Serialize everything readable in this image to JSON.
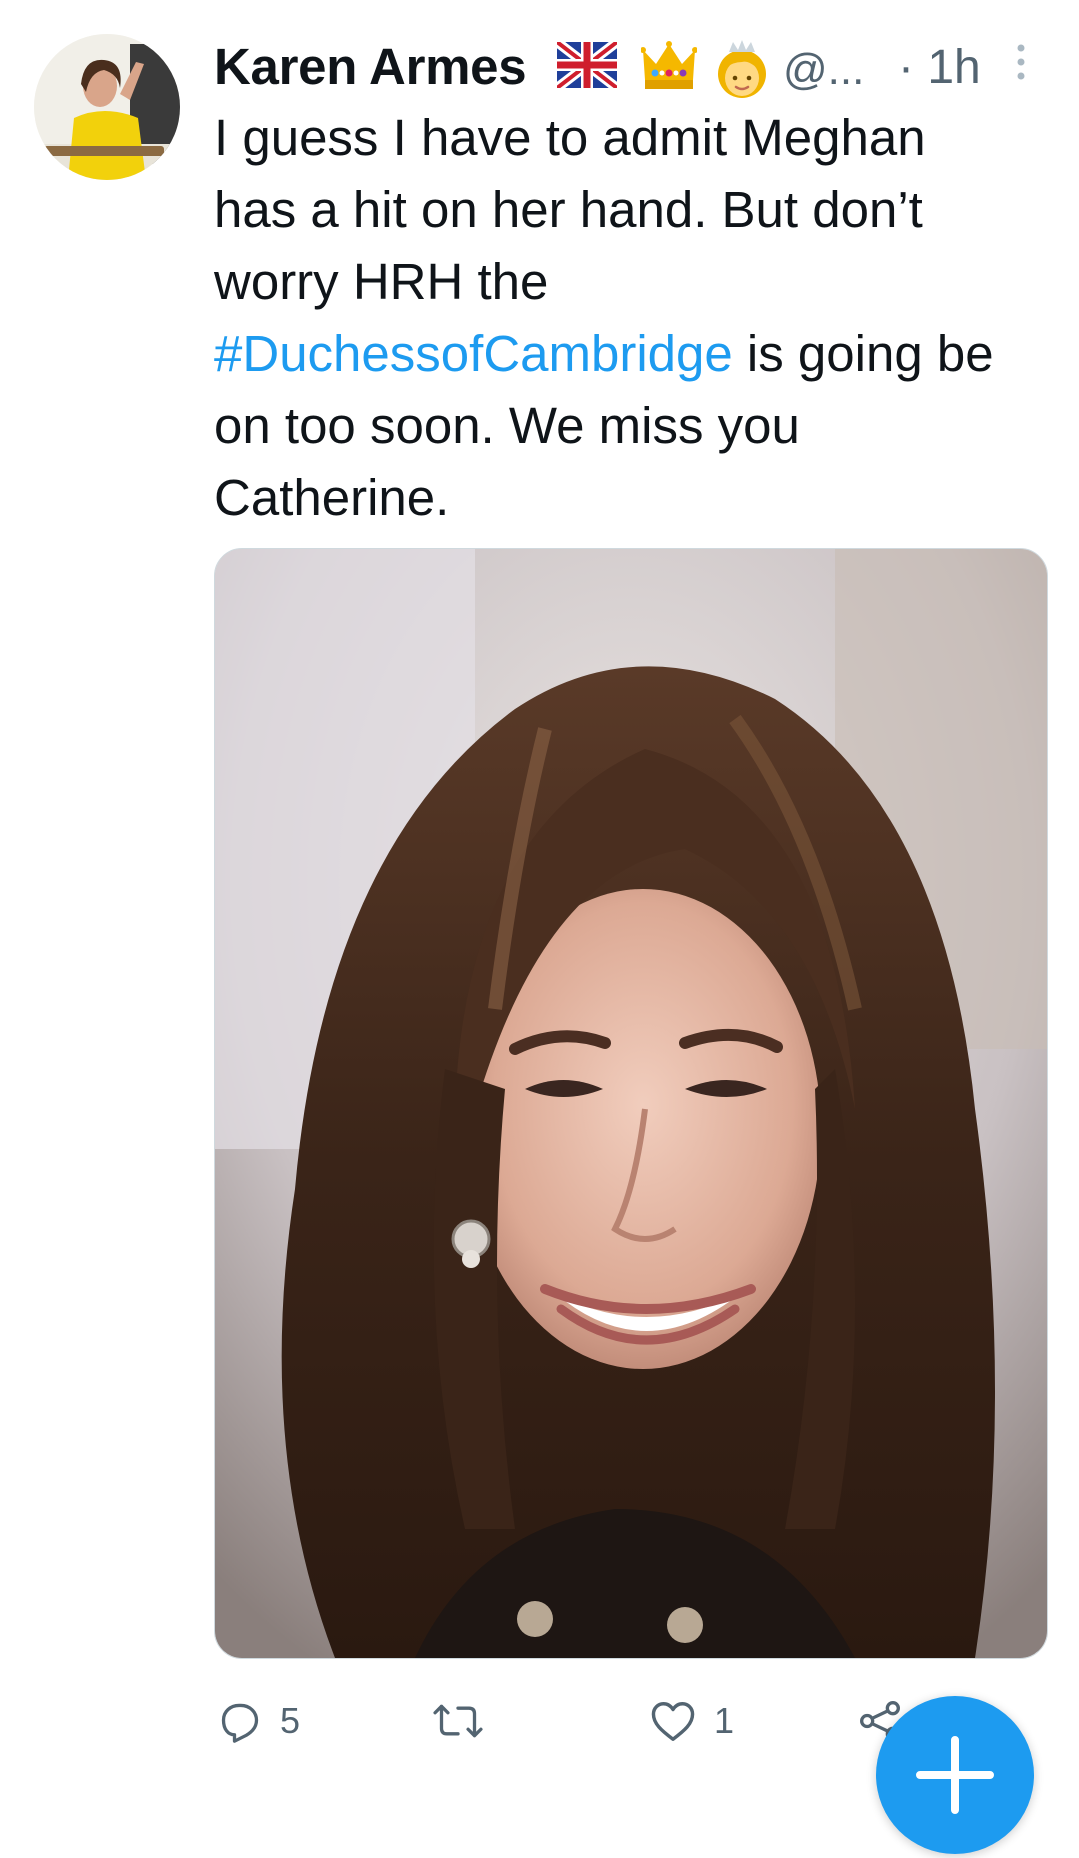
{
  "tweet": {
    "author_name": "Karen Armes",
    "handle": "@...",
    "time": "· 1h",
    "emojis": [
      "uk-flag-icon",
      "crown-icon",
      "princess-icon"
    ],
    "text_lines": [
      "I guess I have to admit Meghan",
      "has a hit on her hand. But don’t",
      "worry HRH the"
    ],
    "hashtag": "#DuchessofCambridge",
    "text_after_hashtag": " is going be",
    "text_lines_end": [
      "on too soon. We miss you",
      "Catherine."
    ]
  },
  "actions": {
    "reply_count": "5",
    "retweet_count": "",
    "like_count": "1"
  },
  "colors": {
    "link": "#1d9bf0",
    "secondary_text": "#536471",
    "fab": "#1d9bf0"
  }
}
